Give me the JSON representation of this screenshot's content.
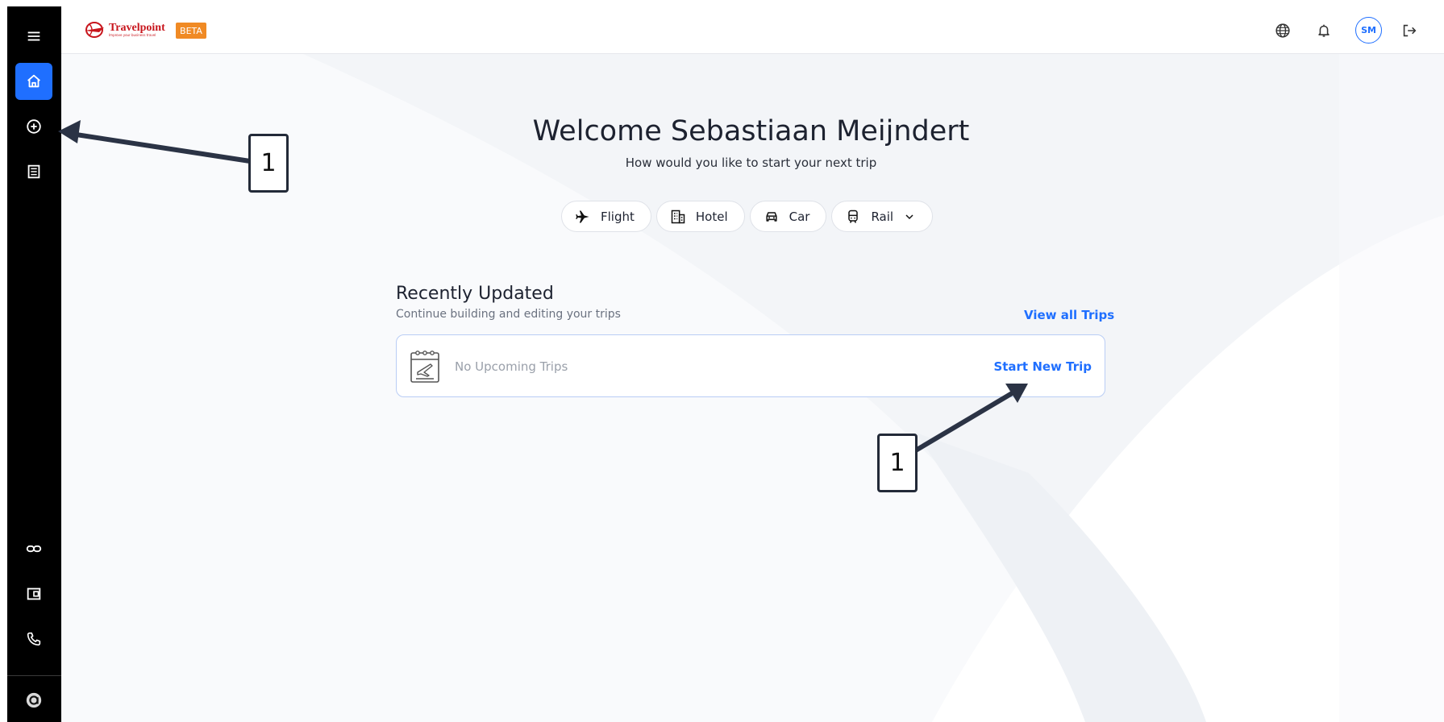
{
  "header": {
    "logo_text": "Travelpoint",
    "logo_tagline": "Improve your business travel",
    "beta_label": "BETA",
    "avatar_initials": "SM"
  },
  "sidebar": {
    "items": [
      {
        "name": "home",
        "active": true
      },
      {
        "name": "add"
      },
      {
        "name": "trips-list"
      },
      {
        "name": "link"
      },
      {
        "name": "wallet"
      },
      {
        "name": "phone"
      },
      {
        "name": "account"
      }
    ]
  },
  "main": {
    "welcome": "Welcome Sebastiaan Meijndert",
    "subtitle": "How would you like to start your next trip",
    "modes": [
      {
        "label": "Flight",
        "icon": "airplane-icon"
      },
      {
        "label": "Hotel",
        "icon": "building-icon"
      },
      {
        "label": "Car",
        "icon": "car-icon"
      },
      {
        "label": "Rail",
        "icon": "train-icon"
      }
    ],
    "recent": {
      "title": "Recently Updated",
      "subtitle": "Continue building and editing your trips",
      "view_all": "View all Trips",
      "empty_text": "No Upcoming Trips",
      "start_trip": "Start New Trip"
    }
  },
  "annotations": {
    "callout_1": "1",
    "callout_2": "1"
  },
  "colors": {
    "accent": "#1f6fff",
    "sidebar": "#000000",
    "beta": "#f08a24"
  }
}
